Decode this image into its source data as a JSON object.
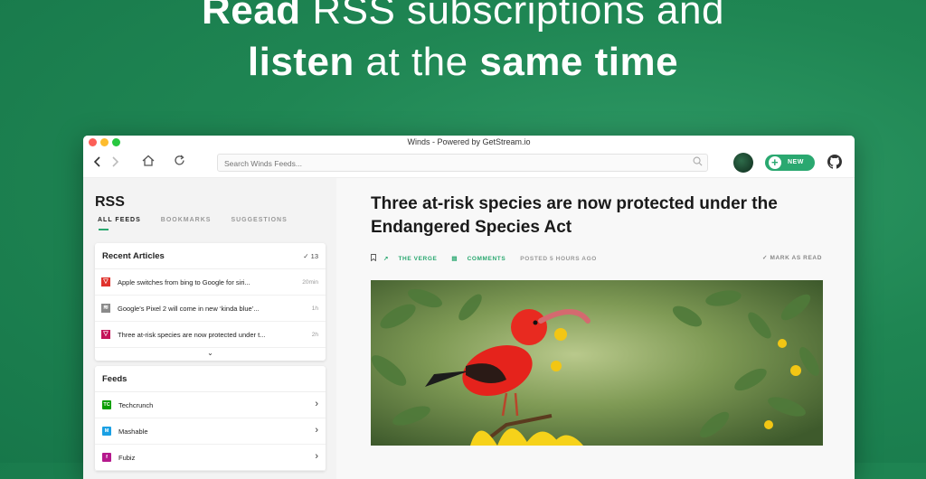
{
  "hero": {
    "line1_bold": "Read",
    "line1_rest": " RSS subscriptions and",
    "line2_bold1": "listen",
    "line2_mid": " at the ",
    "line2_bold2": "same time"
  },
  "window": {
    "title": "Winds - Powered by GetStream.io"
  },
  "toolbar": {
    "search_placeholder": "Search Winds Feeds...",
    "new_label": "NEW"
  },
  "sidebar": {
    "title": "RSS",
    "tabs": [
      "ALL FEEDS",
      "BOOKMARKS",
      "SUGGESTIONS"
    ],
    "recent": {
      "title": "Recent Articles",
      "count": "13",
      "items": [
        {
          "text": "Apple switches from bing to Google for siri...",
          "time": "20min",
          "icon_color": "#e0322c"
        },
        {
          "text": "Google’s Pixel 2 will come in new ‘kinda blue’...",
          "time": "1h",
          "icon_color": "#8a8a8a"
        },
        {
          "text": "Three at-risk species are now protected under t...",
          "time": "2h",
          "icon_color": "#c4145a"
        }
      ]
    },
    "feeds": {
      "title": "Feeds",
      "items": [
        {
          "name": "Techcrunch",
          "abbr": "TC",
          "color": "#0a9e01"
        },
        {
          "name": "Mashable",
          "abbr": "M",
          "color": "#1aa0e4"
        },
        {
          "name": "Fubiz",
          "abbr": "f",
          "color": "#b5198d"
        }
      ]
    }
  },
  "article": {
    "title": "Three at-risk species are now protected under the Endangered Species Act",
    "source": "THE VERGE",
    "comments": "COMMENTS",
    "posted": "POSTED 5 HOURS AGO",
    "mark_read": "MARK AS READ"
  },
  "colors": {
    "accent": "#2aa870",
    "background": "#1f8653"
  }
}
